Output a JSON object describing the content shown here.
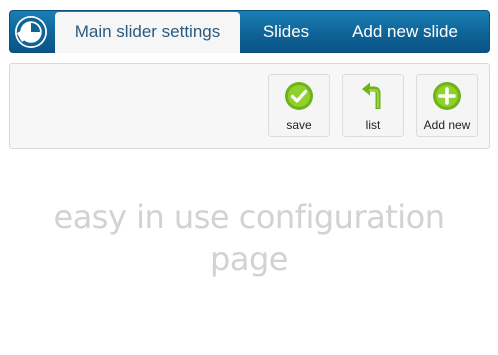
{
  "header": {
    "tabs": {
      "main_settings": "Main slider settings",
      "slides": "Slides",
      "add_new_slide": "Add new slide"
    },
    "colors": {
      "bar": "#0f6397",
      "active_tab_bg": "#f6f6f6",
      "active_tab_text": "#2a5a80"
    }
  },
  "toolbar": {
    "buttons": {
      "save": {
        "label": "save",
        "icon": "checkmark-circle-icon"
      },
      "list": {
        "label": "list",
        "icon": "back-arrow-icon"
      },
      "add": {
        "label": "Add new",
        "icon": "plus-circle-icon"
      }
    },
    "icon_color": "#7cc018"
  },
  "caption": {
    "line1": "easy in use configuration",
    "line2": "page"
  }
}
